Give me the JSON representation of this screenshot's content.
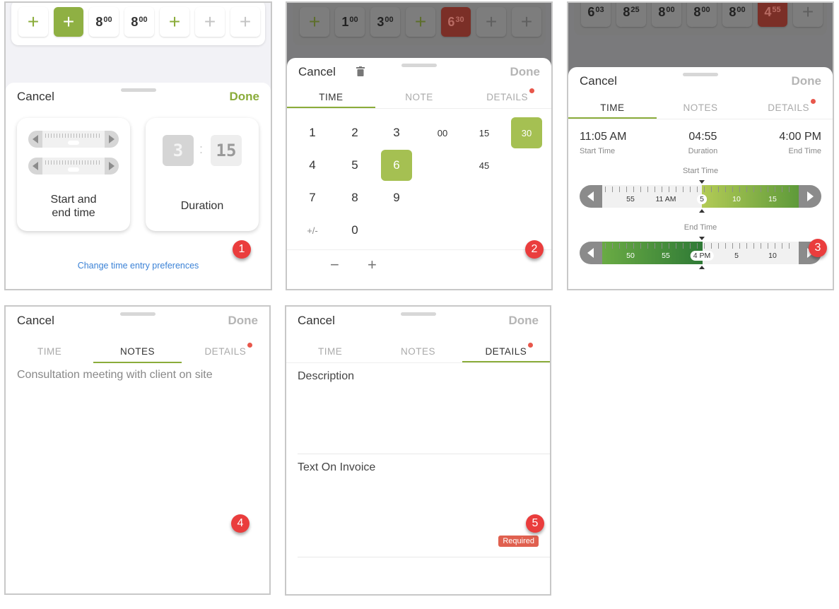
{
  "sheet": {
    "cancel": "Cancel",
    "done": "Done"
  },
  "panel1": {
    "days": [
      {
        "type": "plus",
        "state": "normal"
      },
      {
        "type": "plus",
        "state": "active"
      },
      {
        "type": "hours",
        "h": "8",
        "m": "00"
      },
      {
        "type": "hours",
        "h": "8",
        "m": "00"
      },
      {
        "type": "plus",
        "state": "normal"
      },
      {
        "type": "plus",
        "state": "disabled"
      },
      {
        "type": "plus",
        "state": "disabled"
      }
    ],
    "card_start_end": "Start and end time",
    "card_start_end_line1": "Start and",
    "card_start_end_line2": "end time",
    "card_duration": "Duration",
    "duration_preview": {
      "hours": "3",
      "minutes": "15"
    },
    "link": "Change time entry preferences",
    "step": "1"
  },
  "panel2": {
    "days": [
      {
        "type": "plus",
        "state": "normal"
      },
      {
        "type": "hours",
        "h": "1",
        "m": "00"
      },
      {
        "type": "hours",
        "h": "3",
        "m": "00"
      },
      {
        "type": "plus",
        "state": "normal"
      },
      {
        "type": "hours",
        "h": "6",
        "m": "30",
        "state": "over"
      },
      {
        "type": "plus",
        "state": "disabled"
      },
      {
        "type": "plus",
        "state": "disabled"
      }
    ],
    "tabs": [
      "TIME",
      "NOTE",
      "DETAILS"
    ],
    "active_tab": 0,
    "keys": {
      "digits": [
        "1",
        "2",
        "3",
        "4",
        "5",
        "6",
        "7",
        "8",
        "9",
        "+/-",
        "0"
      ],
      "minutes": [
        "00",
        "15",
        "30",
        "45"
      ],
      "selected_hour": "6",
      "selected_minutes": "30"
    },
    "minus": "−",
    "plus": "+",
    "step": "2"
  },
  "panel3": {
    "days": [
      {
        "type": "hours",
        "h": "6",
        "m": "03"
      },
      {
        "type": "hours",
        "h": "8",
        "m": "25"
      },
      {
        "type": "hours",
        "h": "8",
        "m": "00"
      },
      {
        "type": "hours",
        "h": "8",
        "m": "00"
      },
      {
        "type": "hours",
        "h": "8",
        "m": "00"
      },
      {
        "type": "hours",
        "h": "4",
        "m": "55",
        "state": "over"
      },
      {
        "type": "plus",
        "state": "disabled"
      }
    ],
    "tabs": [
      "TIME",
      "NOTES",
      "DETAILS"
    ],
    "active_tab": 0,
    "start_time": {
      "value": "11:05 AM",
      "label": "Start Time"
    },
    "duration": {
      "value": "04:55",
      "label": "Duration"
    },
    "end_time": {
      "value": "4:00 PM",
      "label": "End Time"
    },
    "start_ruler": {
      "label": "Start Time",
      "ticks": [
        "55",
        "11 AM",
        "5",
        "10",
        "15"
      ],
      "current": "5"
    },
    "end_ruler": {
      "label": "End Time",
      "ticks": [
        "50",
        "55",
        "4 PM",
        "5",
        "10"
      ],
      "current": "4 PM"
    },
    "step": "3"
  },
  "panel4": {
    "tabs": [
      "TIME",
      "NOTES",
      "DETAILS"
    ],
    "active_tab": 1,
    "note": "Consultation meeting with client on site",
    "step": "4"
  },
  "panel5": {
    "tabs": [
      "TIME",
      "NOTES",
      "DETAILS"
    ],
    "active_tab": 2,
    "description_label": "Description",
    "invoice_label": "Text On Invoice",
    "required": "Required",
    "step": "5"
  },
  "colors": {
    "accent": "#8aac3a",
    "selected": "#a5c052",
    "alert": "#e8574b",
    "link": "#3b82d6"
  }
}
